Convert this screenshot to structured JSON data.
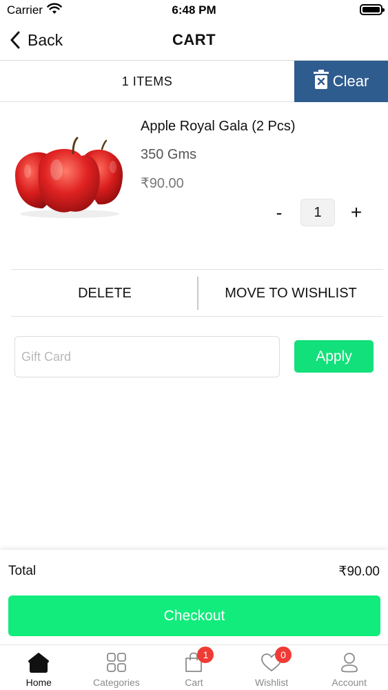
{
  "status_bar": {
    "carrier": "Carrier",
    "time": "6:48 PM"
  },
  "nav": {
    "back_label": "Back",
    "title": "CART"
  },
  "cart_bar": {
    "items_count": "1 ITEMS",
    "clear_label": "Clear"
  },
  "product": {
    "name": "Apple Royal Gala (2 Pcs)",
    "weight": "350 Gms",
    "price": "₹90.00",
    "quantity": "1",
    "minus_label": "-",
    "plus_label": "+"
  },
  "actions": {
    "delete_label": "DELETE",
    "wishlist_label": "MOVE TO WISHLIST"
  },
  "gift_card": {
    "placeholder": "Gift Card",
    "apply_label": "Apply"
  },
  "summary": {
    "total_label": "Total",
    "total_value": "₹90.00",
    "checkout_label": "Checkout"
  },
  "tab_bar": {
    "items": [
      {
        "label": "Home",
        "icon": "home-icon",
        "active": true
      },
      {
        "label": "Categories",
        "icon": "categories-icon"
      },
      {
        "label": "Cart",
        "icon": "cart-icon",
        "badge": "1"
      },
      {
        "label": "Wishlist",
        "icon": "heart-icon",
        "badge": "0"
      },
      {
        "label": "Account",
        "icon": "account-icon"
      }
    ]
  },
  "colors": {
    "clear_button": "#2f5c8e",
    "apply_button": "#12e07a",
    "checkout_button": "#12ec7c",
    "badge": "#ef3b36"
  }
}
